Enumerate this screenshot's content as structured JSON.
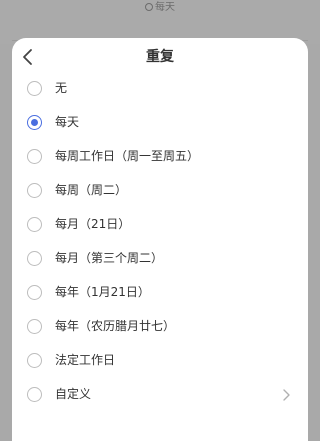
{
  "backdrop": {
    "hint_text": "每天"
  },
  "sheet": {
    "title": "重复",
    "options": [
      {
        "label": "无",
        "selected": false
      },
      {
        "label": "每天",
        "selected": true
      },
      {
        "label": "每周工作日（周一至周五）",
        "selected": false
      },
      {
        "label": "每周（周二）",
        "selected": false
      },
      {
        "label": "每月（21日）",
        "selected": false
      },
      {
        "label": "每月（第三个周二）",
        "selected": false
      },
      {
        "label": "每年（1月21日）",
        "selected": false
      },
      {
        "label": "每年（农历腊月廿七）",
        "selected": false
      },
      {
        "label": "法定工作日",
        "selected": false
      },
      {
        "label": "自定义",
        "selected": false,
        "has_chevron": true
      }
    ]
  },
  "colors": {
    "accent": "#4a6ee0",
    "backdrop": "#a9a9a9",
    "text": "#333333"
  },
  "icons": {
    "back": "chevron-left-icon",
    "more": "chevron-right-icon",
    "hint": "repeat-icon"
  }
}
